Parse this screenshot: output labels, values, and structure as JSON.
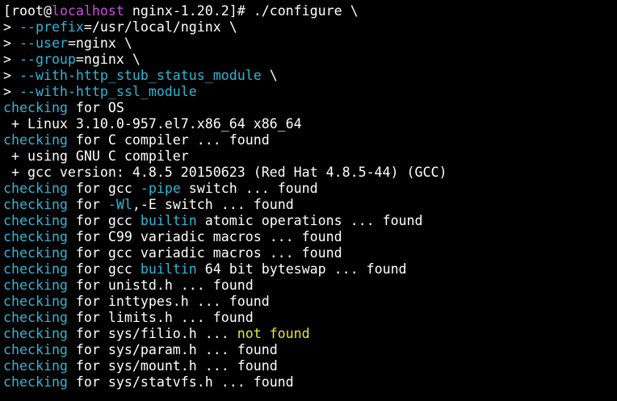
{
  "colors": {
    "background": "#000000",
    "text": "#ffffff",
    "cyan": "#2eb6d6",
    "magenta": "#c84fe0",
    "yellow": "#e6e62e"
  },
  "lines": [
    [
      {
        "t": "[root@",
        "c": "w"
      },
      {
        "t": "localhost",
        "c": "m"
      },
      {
        "t": " nginx-1.20.2]# ./configure \\",
        "c": "w"
      }
    ],
    [
      {
        "t": "> ",
        "c": "w"
      },
      {
        "t": "--prefix",
        "c": "c"
      },
      {
        "t": "=/usr/local/nginx \\",
        "c": "w"
      }
    ],
    [
      {
        "t": "> ",
        "c": "w"
      },
      {
        "t": "--user",
        "c": "c"
      },
      {
        "t": "=nginx \\",
        "c": "w"
      }
    ],
    [
      {
        "t": "> ",
        "c": "w"
      },
      {
        "t": "--group",
        "c": "c"
      },
      {
        "t": "=nginx \\",
        "c": "w"
      }
    ],
    [
      {
        "t": "> ",
        "c": "w"
      },
      {
        "t": "--with-http_stub_status_module",
        "c": "c"
      },
      {
        "t": " \\",
        "c": "w"
      }
    ],
    [
      {
        "t": "> ",
        "c": "w"
      },
      {
        "t": "--with-http_ssl_module",
        "c": "c"
      }
    ],
    [
      {
        "t": "checking",
        "c": "c"
      },
      {
        "t": " for OS",
        "c": "w"
      }
    ],
    [
      {
        "t": " + Linux 3.10.0-957.el7.x86_64 x86_64",
        "c": "w"
      }
    ],
    [
      {
        "t": "checking",
        "c": "c"
      },
      {
        "t": " for C compiler ... found",
        "c": "w"
      }
    ],
    [
      {
        "t": " + using GNU C compiler",
        "c": "w"
      }
    ],
    [
      {
        "t": " + gcc version: 4.8.5 20150623 (Red Hat 4.8.5-44) (GCC)",
        "c": "w"
      }
    ],
    [
      {
        "t": "checking",
        "c": "c"
      },
      {
        "t": " for gcc ",
        "c": "w"
      },
      {
        "t": "-pipe",
        "c": "c"
      },
      {
        "t": " switch ... found",
        "c": "w"
      }
    ],
    [
      {
        "t": "checking",
        "c": "c"
      },
      {
        "t": " for ",
        "c": "w"
      },
      {
        "t": "-Wl",
        "c": "c"
      },
      {
        "t": ",-E switch ... found",
        "c": "w"
      }
    ],
    [
      {
        "t": "checking",
        "c": "c"
      },
      {
        "t": " for gcc ",
        "c": "w"
      },
      {
        "t": "builtin",
        "c": "c"
      },
      {
        "t": " atomic operations ... found",
        "c": "w"
      }
    ],
    [
      {
        "t": "checking",
        "c": "c"
      },
      {
        "t": " for C99 variadic macros ... found",
        "c": "w"
      }
    ],
    [
      {
        "t": "checking",
        "c": "c"
      },
      {
        "t": " for gcc variadic macros ... found",
        "c": "w"
      }
    ],
    [
      {
        "t": "checking",
        "c": "c"
      },
      {
        "t": " for gcc ",
        "c": "w"
      },
      {
        "t": "builtin",
        "c": "c"
      },
      {
        "t": " 64 bit byteswap ... found",
        "c": "w"
      }
    ],
    [
      {
        "t": "checking",
        "c": "c"
      },
      {
        "t": " for unistd.h ... found",
        "c": "w"
      }
    ],
    [
      {
        "t": "checking",
        "c": "c"
      },
      {
        "t": " for inttypes.h ... found",
        "c": "w"
      }
    ],
    [
      {
        "t": "checking",
        "c": "c"
      },
      {
        "t": " for limits.h ... found",
        "c": "w"
      }
    ],
    [
      {
        "t": "checking",
        "c": "c"
      },
      {
        "t": " for sys/filio.h ... ",
        "c": "w"
      },
      {
        "t": "not found",
        "c": "y"
      }
    ],
    [
      {
        "t": "checking",
        "c": "c"
      },
      {
        "t": " for sys/param.h ... found",
        "c": "w"
      }
    ],
    [
      {
        "t": "checking",
        "c": "c"
      },
      {
        "t": " for sys/mount.h ... found",
        "c": "w"
      }
    ],
    [
      {
        "t": "checking",
        "c": "c"
      },
      {
        "t": " for sys/statvfs.h ... found",
        "c": "w"
      }
    ]
  ]
}
